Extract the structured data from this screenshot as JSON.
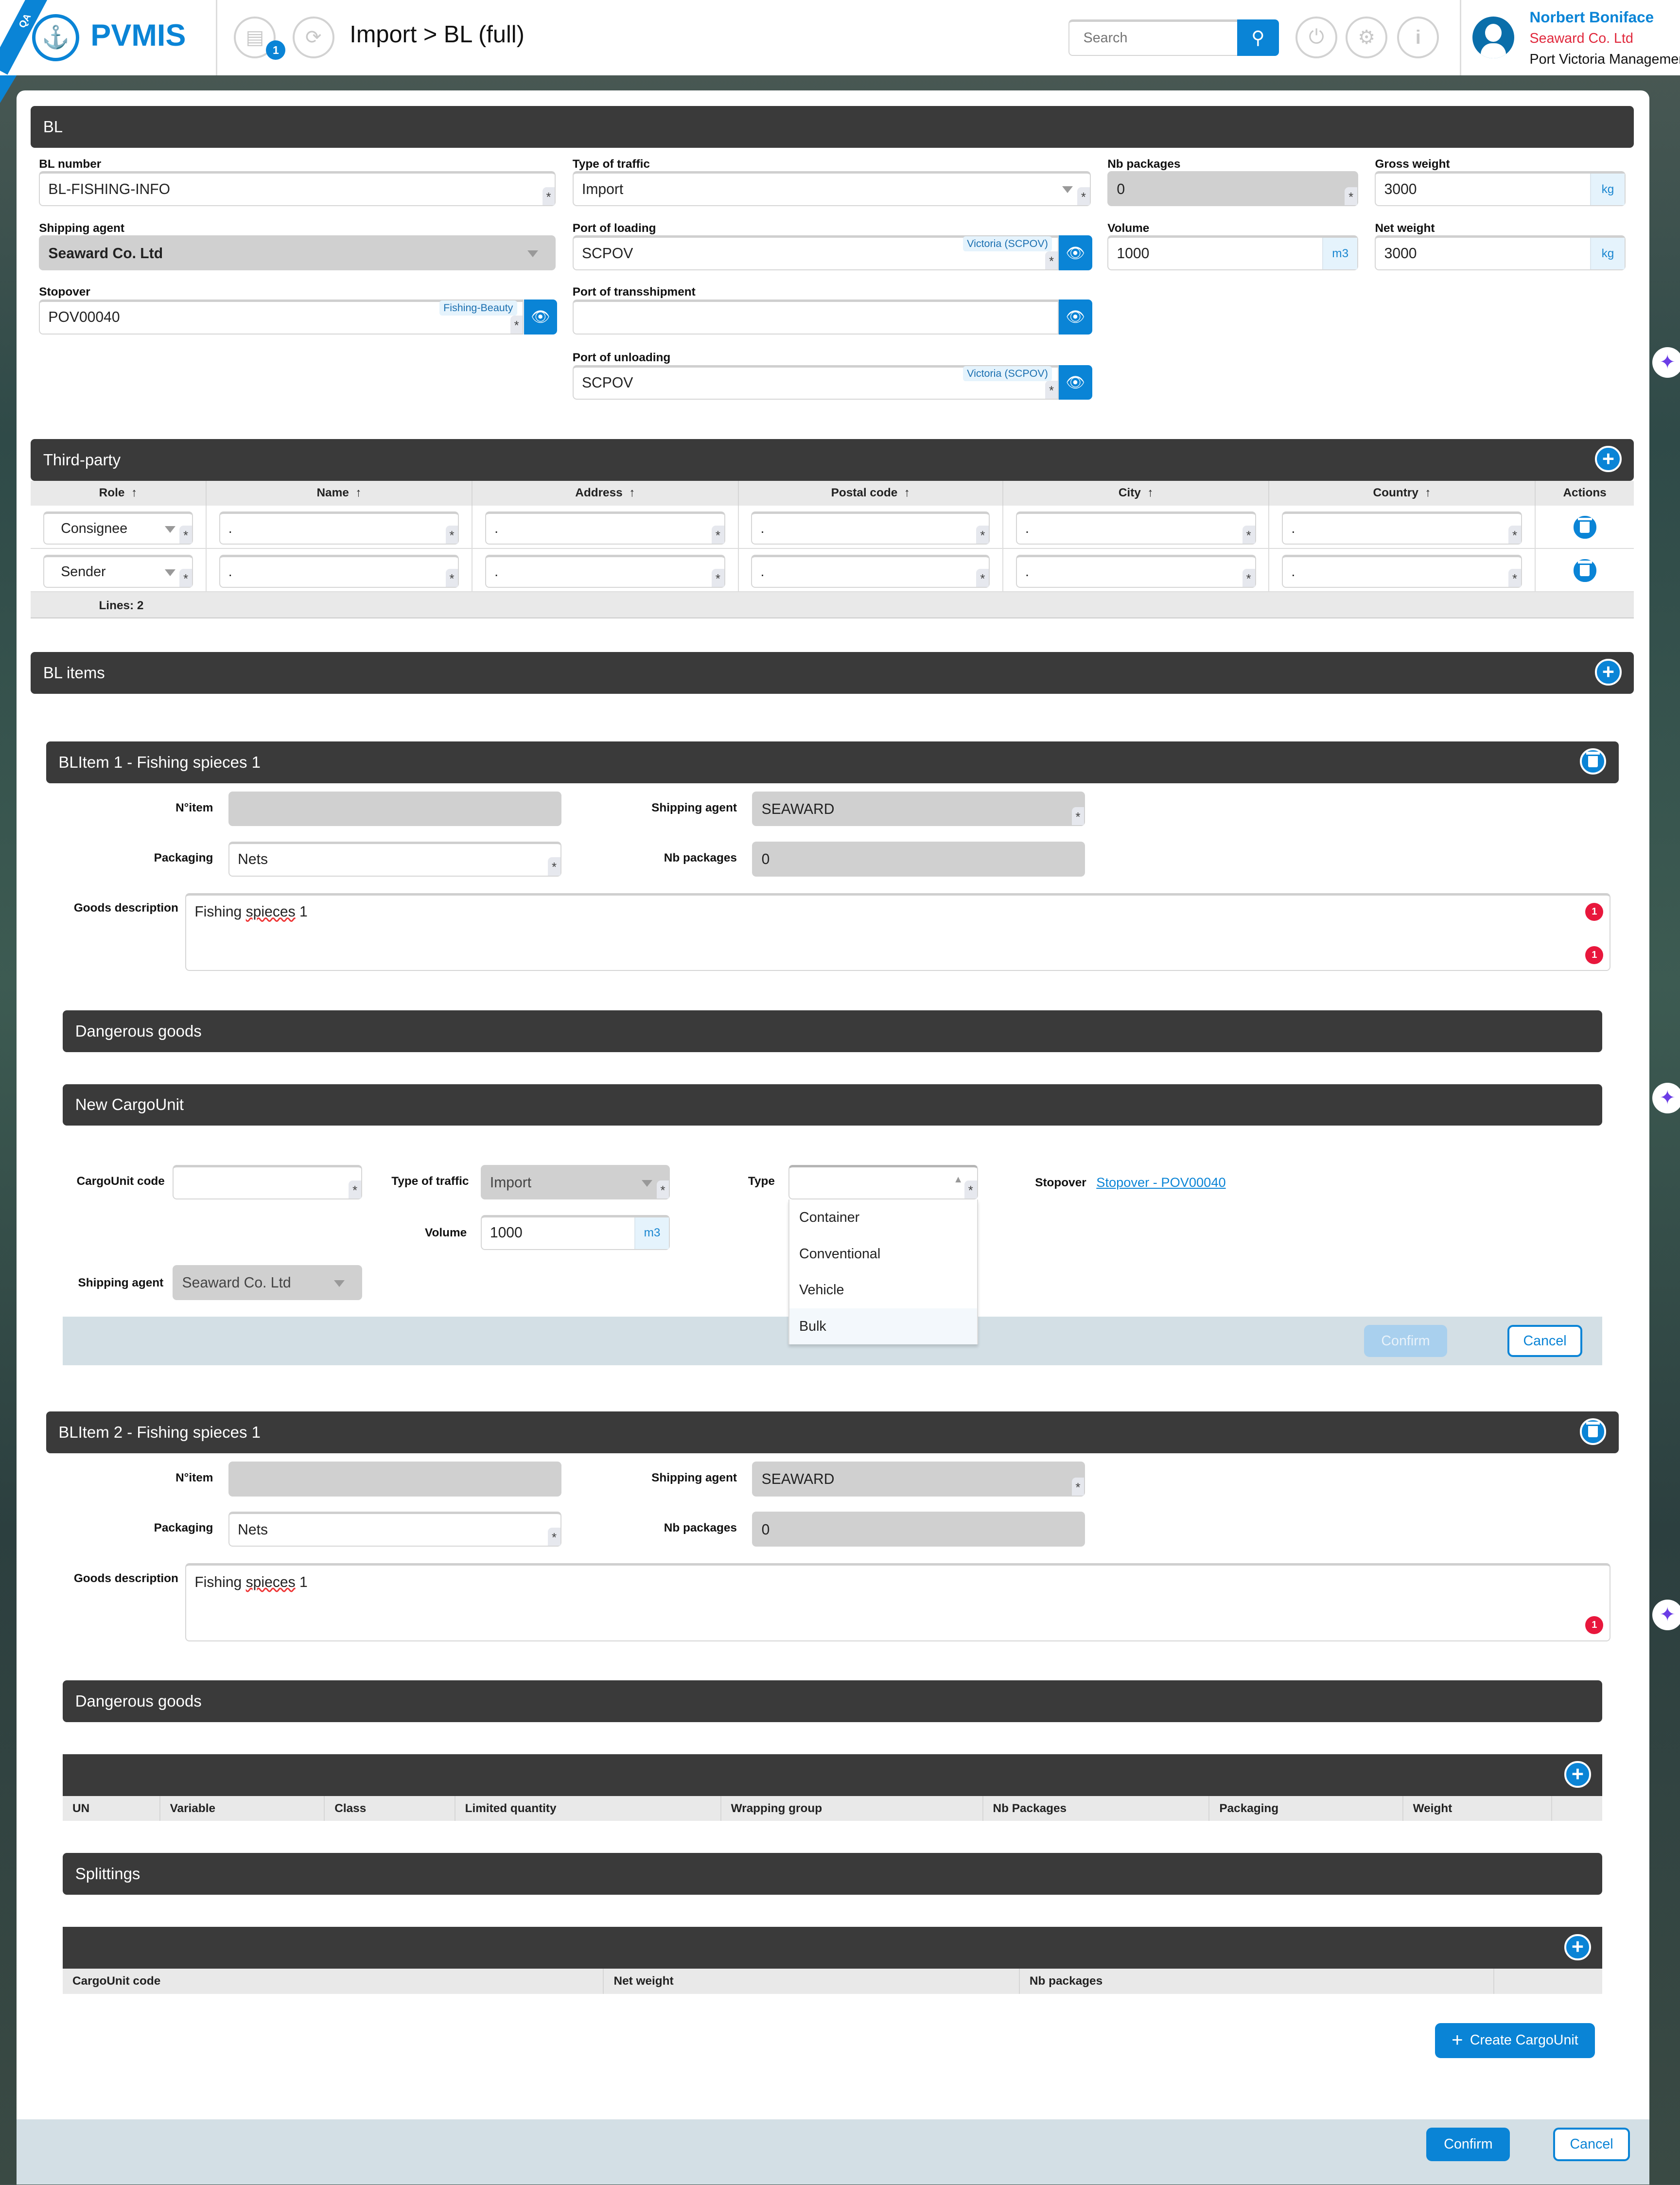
{
  "header": {
    "env_ribbon": "QA",
    "logo_text": "PVMIS",
    "notification_count": "1",
    "title": "Import > BL (full)",
    "search_placeholder": "Search",
    "user": {
      "name": "Norbert Boniface",
      "company": "Seaward Co. Ltd",
      "organization": "Port Victoria Management"
    }
  },
  "colors": {
    "accent": "#0a84d6",
    "section_bar": "#3a3a3a",
    "error": "#e8173c",
    "company_text": "#e0283c"
  },
  "bl": {
    "title": "BL",
    "bl_number": {
      "label": "BL number",
      "value": "BL-FISHING-INFO"
    },
    "type_of_traffic": {
      "label": "Type of traffic",
      "value": "Import"
    },
    "nb_packages": {
      "label": "Nb packages",
      "value": "0"
    },
    "gross_weight": {
      "label": "Gross weight",
      "value": "3000",
      "unit": "kg"
    },
    "shipping_agent": {
      "label": "Shipping agent",
      "value": "Seaward Co. Ltd"
    },
    "port_of_loading": {
      "label": "Port of loading",
      "value": "SCPOV",
      "tag": "Victoria (SCPOV)"
    },
    "volume": {
      "label": "Volume",
      "value": "1000",
      "unit": "m3"
    },
    "net_weight": {
      "label": "Net weight",
      "value": "3000",
      "unit": "kg"
    },
    "stopover": {
      "label": "Stopover",
      "value": "POV00040",
      "tag": "Fishing-Beauty"
    },
    "port_of_transshipment": {
      "label": "Port of transshipment",
      "value": ""
    },
    "port_of_unloading": {
      "label": "Port of unloading",
      "value": "SCPOV",
      "tag": "Victoria (SCPOV)"
    }
  },
  "third_party": {
    "title": "Third-party",
    "columns": [
      "Role",
      "Name",
      "Address",
      "Postal code",
      "City",
      "Country",
      "Actions"
    ],
    "rows": [
      {
        "role": "Consignee",
        "name": ".",
        "address": ".",
        "postal": ".",
        "city": ".",
        "country": "."
      },
      {
        "role": "Sender",
        "name": ".",
        "address": ".",
        "postal": ".",
        "city": ".",
        "country": "."
      }
    ],
    "footer": "Lines: 2"
  },
  "bl_items": {
    "title": "BL items",
    "items": [
      {
        "title": "BLItem 1 - Fishing spieces 1",
        "labels": {
          "nitem": "N°item",
          "shipping_agent": "Shipping agent",
          "packaging": "Packaging",
          "nb_packages": "Nb packages",
          "goods": "Goods description"
        },
        "nitem": "",
        "shipping_agent": "SEAWARD",
        "packaging": "Nets",
        "nb_packages": "0",
        "goods_word1": "Fishing",
        "goods_word2": "spieces",
        "goods_word3": "1",
        "error_count": "1",
        "dangerous_goods": "Dangerous goods",
        "new_cargo_unit": {
          "title": "New CargoUnit",
          "code_label": "CargoUnit code",
          "code_value": "",
          "traffic_label": "Type of traffic",
          "traffic_value": "Import",
          "type_label": "Type",
          "type_value": "",
          "type_options": [
            "Container",
            "Conventional",
            "Vehicle",
            "Bulk"
          ],
          "type_highlighted": "Bulk",
          "stopover_label": "Stopover",
          "stopover_link": "Stopover - POV00040",
          "volume_label": "Volume",
          "volume_value": "1000",
          "volume_unit": "m3",
          "agent_label": "Shipping agent",
          "agent_value": "Seaward Co. Ltd",
          "confirm": "Confirm",
          "cancel": "Cancel"
        }
      },
      {
        "title": "BLItem 2 - Fishing spieces 1",
        "labels": {
          "nitem": "N°item",
          "shipping_agent": "Shipping agent",
          "packaging": "Packaging",
          "nb_packages": "Nb packages",
          "goods": "Goods description"
        },
        "nitem": "",
        "shipping_agent": "SEAWARD",
        "packaging": "Nets",
        "nb_packages": "0",
        "goods_word1": "Fishing",
        "goods_word2": "spieces",
        "goods_word3": "1",
        "error_count": "1",
        "dangerous_goods": "Dangerous goods",
        "dg_columns": [
          "UN",
          "Variable",
          "Class",
          "Limited quantity",
          "Wrapping group",
          "Nb Packages",
          "Packaging",
          "Weight"
        ],
        "splittings": "Splittings",
        "split_columns": [
          "CargoUnit code",
          "Net weight",
          "Nb packages"
        ],
        "create_cargo_unit": "Create CargoUnit"
      }
    ]
  },
  "footer": {
    "confirm": "Confirm",
    "cancel": "Cancel"
  }
}
